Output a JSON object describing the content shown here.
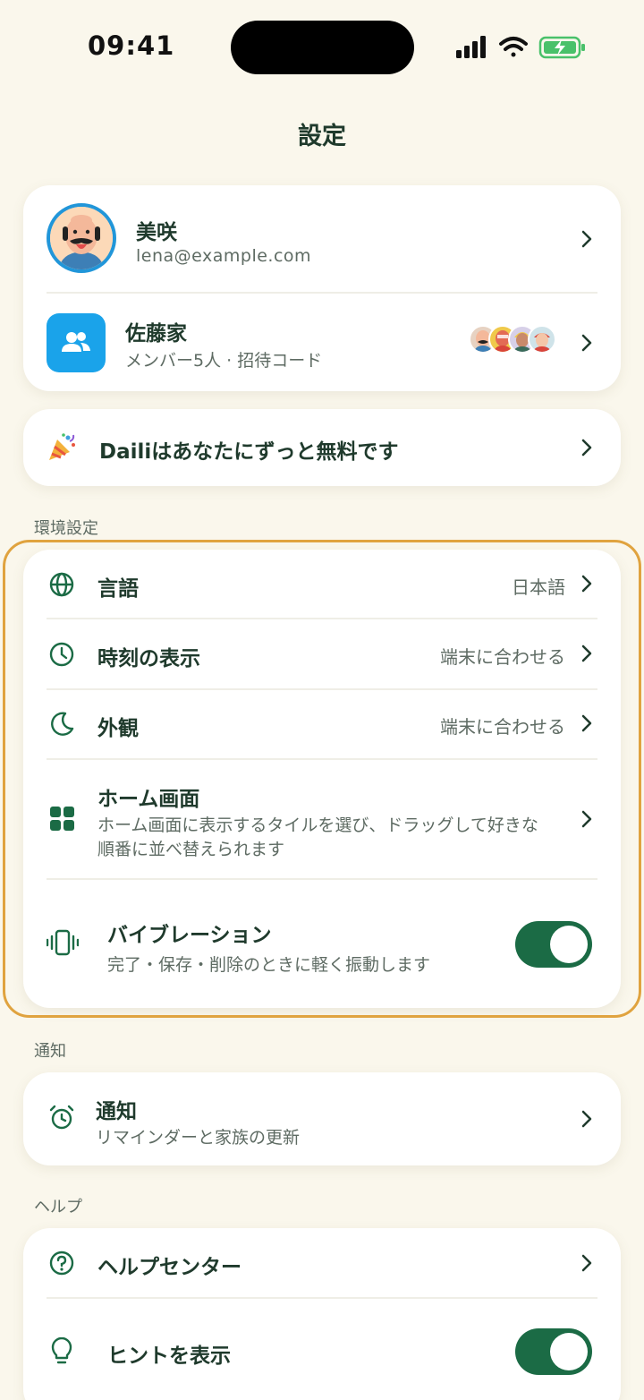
{
  "status_bar": {
    "time": "09:41"
  },
  "page": {
    "title": "設定"
  },
  "profile": {
    "name": "美咲",
    "email": "lena@example.com"
  },
  "family": {
    "name": "佐藤家",
    "subtitle": "メンバー5人 · 招待コード"
  },
  "promo": {
    "label": "Dailiはあなたにずっと無料です"
  },
  "sections": {
    "preferences": "環境設定",
    "notifications": "通知",
    "help": "ヘルプ"
  },
  "preferences": {
    "language": {
      "label": "言語",
      "value": "日本語"
    },
    "time_display": {
      "label": "時刻の表示",
      "value": "端末に合わせる"
    },
    "appearance": {
      "label": "外観",
      "value": "端末に合わせる"
    },
    "home_screen": {
      "label": "ホーム画面",
      "desc_line1": "ホーム画面に表示するタイルを選び、ドラッグして好きな",
      "desc_line2": "順番に並べ替えられます"
    },
    "vibration": {
      "label": "バイブレーション",
      "desc": "完了・保存・削除のときに軽く振動します",
      "enabled": true
    }
  },
  "notifications": {
    "label": "通知",
    "desc": "リマインダーと家族の更新"
  },
  "help": {
    "help_center": {
      "label": "ヘルプセンター"
    },
    "show_hints": {
      "label": "ヒントを表示",
      "enabled": true
    }
  },
  "colors": {
    "accent": "#1b6b45",
    "background": "#faf7ec",
    "highlight": "#e0a33f",
    "family_blue": "#1aa3ea"
  }
}
